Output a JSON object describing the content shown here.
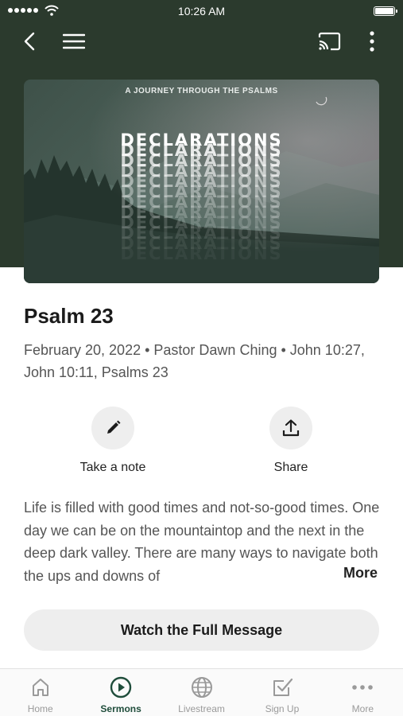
{
  "status_bar": {
    "time": "10:26 AM"
  },
  "hero": {
    "kicker": "A JOURNEY THROUGH THE PSALMS",
    "title_word": "DECLARATIONS"
  },
  "sermon": {
    "title": "Psalm 23",
    "meta": "February 20, 2022 • Pastor Dawn Ching • John 10:27, John 10:11, Psalms 23",
    "description": "Life is filled with good times and not-so-good times. One day we can be on the mountaintop and the next in the deep dark valley. There are many ways to navigate both the ups and downs of",
    "more_label": "More"
  },
  "actions": {
    "note_label": "Take a note",
    "share_label": "Share"
  },
  "watch_button_label": "Watch the Full Message",
  "tabs": [
    {
      "label": "Home",
      "icon": "home-icon",
      "active": false
    },
    {
      "label": "Sermons",
      "icon": "play-circle-icon",
      "active": true
    },
    {
      "label": "Livestream",
      "icon": "globe-icon",
      "active": false
    },
    {
      "label": "Sign Up",
      "icon": "checkbox-icon",
      "active": false
    },
    {
      "label": "More",
      "icon": "ellipsis-icon",
      "active": false
    }
  ],
  "colors": {
    "header_bg": "#2b3a2d",
    "accent": "#1f4d3b",
    "button_bg": "#eeeeee"
  }
}
